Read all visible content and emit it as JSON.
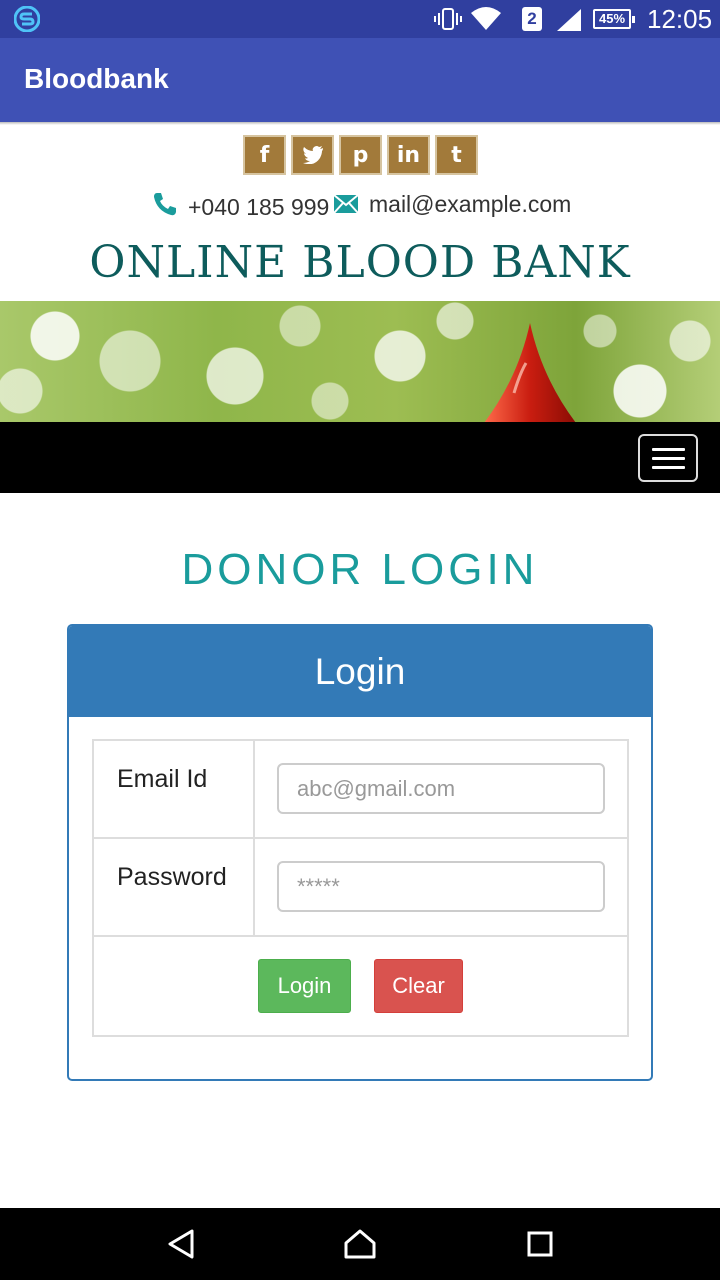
{
  "status_bar": {
    "time": "12:05",
    "battery": "45%",
    "sim_slot": "2"
  },
  "app_bar": {
    "title": "Bloodbank"
  },
  "social": [
    {
      "icon": "facebook-icon",
      "glyph": "f"
    },
    {
      "icon": "twitter-icon",
      "glyph": "t"
    },
    {
      "icon": "pinterest-icon",
      "glyph": "p"
    },
    {
      "icon": "linkedin-icon",
      "glyph": "in"
    },
    {
      "icon": "tumblr-icon",
      "glyph": "t"
    }
  ],
  "contact": {
    "phone": "+040 185 999",
    "email": "mail@example.com"
  },
  "site": {
    "title": "ONLINE BLOOD BANK"
  },
  "page": {
    "heading": "DONOR LOGIN"
  },
  "login_panel": {
    "title": "Login",
    "email_label": "Email Id",
    "email_placeholder": "abc@gmail.com",
    "password_label": "Password",
    "password_placeholder": "*****",
    "login_button": "Login",
    "clear_button": "Clear"
  },
  "colors": {
    "status_bar": "#303f9f",
    "app_bar": "#3f51b5",
    "social_bg": "#a27a3a",
    "title_teal": "#0e5c5c",
    "heading_teal": "#1a9c9c",
    "panel_blue": "#337ab7",
    "login_green": "#5cb85c",
    "clear_red": "#d9534f"
  }
}
